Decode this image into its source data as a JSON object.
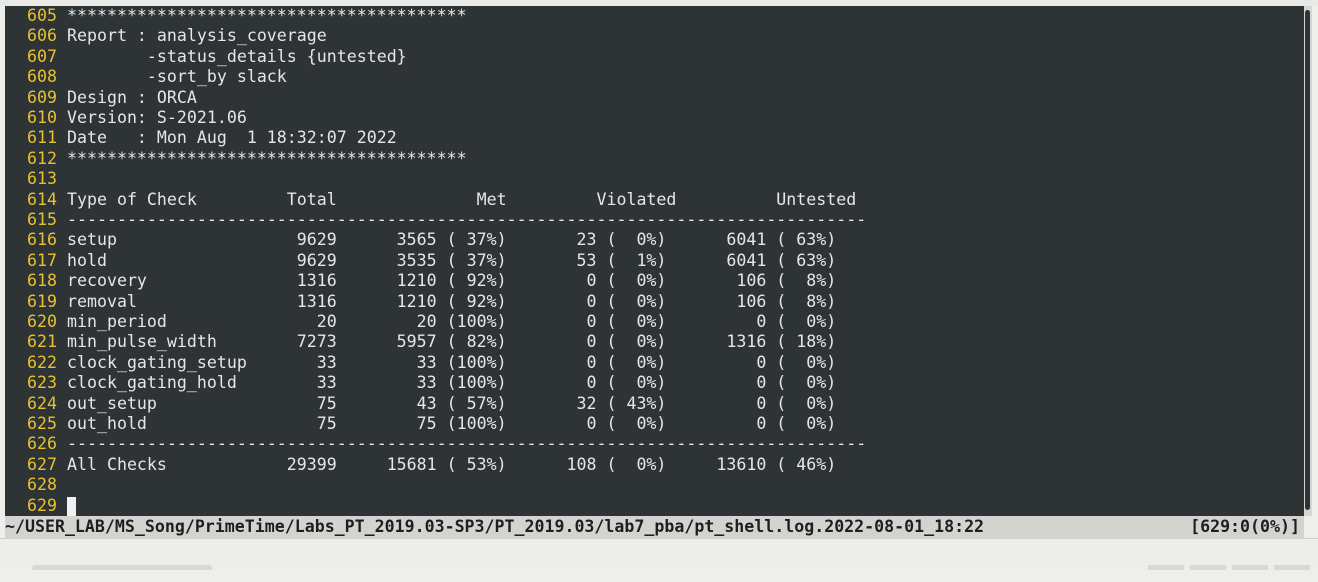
{
  "editor": {
    "lines": [
      {
        "num": "605",
        "text": "****************************************"
      },
      {
        "num": "606",
        "text": "Report : analysis_coverage"
      },
      {
        "num": "607",
        "text": "        -status_details {untested}"
      },
      {
        "num": "608",
        "text": "        -sort_by slack"
      },
      {
        "num": "609",
        "text": "Design : ORCA"
      },
      {
        "num": "610",
        "text": "Version: S-2021.06"
      },
      {
        "num": "611",
        "text": "Date   : Mon Aug  1 18:32:07 2022"
      },
      {
        "num": "612",
        "text": "****************************************"
      },
      {
        "num": "613",
        "text": ""
      },
      {
        "num": "614",
        "text": "Type of Check         Total              Met         Violated          Untested"
      },
      {
        "num": "615",
        "text": "--------------------------------------------------------------------------------"
      },
      {
        "num": "616",
        "text": "setup                  9629      3565 ( 37%)       23 (  0%)      6041 ( 63%)"
      },
      {
        "num": "617",
        "text": "hold                   9629      3535 ( 37%)       53 (  1%)      6041 ( 63%)"
      },
      {
        "num": "618",
        "text": "recovery               1316      1210 ( 92%)        0 (  0%)       106 (  8%)"
      },
      {
        "num": "619",
        "text": "removal                1316      1210 ( 92%)        0 (  0%)       106 (  8%)"
      },
      {
        "num": "620",
        "text": "min_period               20        20 (100%)        0 (  0%)         0 (  0%)"
      },
      {
        "num": "621",
        "text": "min_pulse_width        7273      5957 ( 82%)        0 (  0%)      1316 ( 18%)"
      },
      {
        "num": "622",
        "text": "clock_gating_setup       33        33 (100%)        0 (  0%)         0 (  0%)"
      },
      {
        "num": "623",
        "text": "clock_gating_hold        33        33 (100%)        0 (  0%)         0 (  0%)"
      },
      {
        "num": "624",
        "text": "out_setup                75        43 ( 57%)       32 ( 43%)         0 (  0%)"
      },
      {
        "num": "625",
        "text": "out_hold                 75        75 (100%)        0 (  0%)         0 (  0%)"
      },
      {
        "num": "626",
        "text": "--------------------------------------------------------------------------------"
      },
      {
        "num": "627",
        "text": "All Checks            29399     15681 ( 53%)      108 (  0%)     13610 ( 46%)"
      },
      {
        "num": "628",
        "text": ""
      },
      {
        "num": "629",
        "text": ""
      }
    ]
  },
  "status_bar": {
    "path": "~/USER_LAB/MS_Song/PrimeTime/Labs_PT_2019.03-SP3/PT_2019.03/lab7_pba/pt_shell.log.2022-08-01_18:22",
    "position": "[629:0(0%)]"
  },
  "colors": {
    "background": "#2e3436",
    "line_number": "#e9c12e",
    "text": "#e6e6e6",
    "status_bar": "#d3d3d0"
  }
}
